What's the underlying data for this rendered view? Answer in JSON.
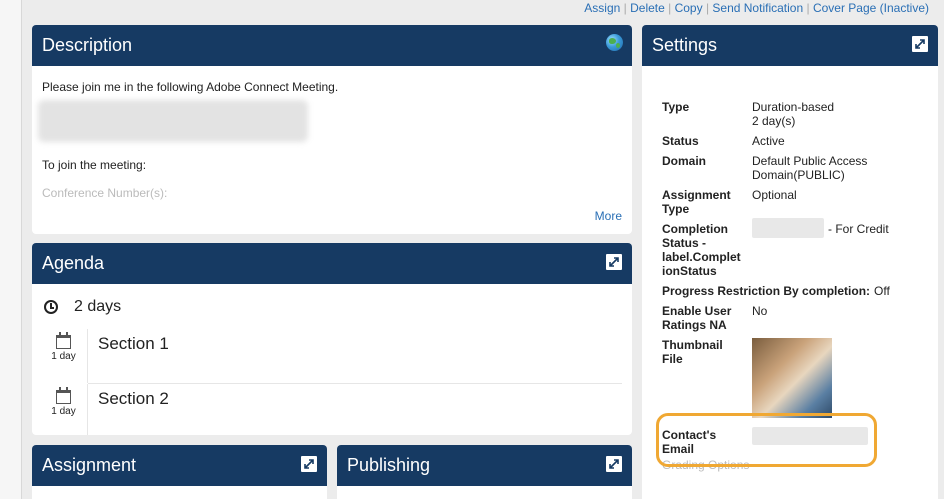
{
  "top_links": [
    "Assign",
    "Delete",
    "Copy",
    "Send Notification",
    "Cover Page (Inactive)"
  ],
  "description": {
    "title": "Description",
    "line1": "Please join me in the following Adobe Connect Meeting.",
    "line2": "To join the meeting:",
    "line3": "Conference Number(s):",
    "more": "More"
  },
  "agenda": {
    "title": "Agenda",
    "duration": "2 days",
    "sections": [
      {
        "day": "1 day",
        "title": "Section 1"
      },
      {
        "day": "1 day",
        "title": "Section 2"
      }
    ]
  },
  "assignment": {
    "title": "Assignment"
  },
  "publishing": {
    "title": "Publishing"
  },
  "settings": {
    "title": "Settings",
    "type_label": "Type",
    "type_value_1": "Duration-based",
    "type_value_2": "2 day(s)",
    "status_label": "Status",
    "status_value": "Active",
    "domain_label": "Domain",
    "domain_value_1": "Default Public Access",
    "domain_value_2": "Domain(PUBLIC)",
    "assignment_type_label_1": "Assignment",
    "assignment_type_label_2": "Type",
    "assignment_type_value": "Optional",
    "completion_label_1": "Completion",
    "completion_label_2": "Status -",
    "completion_label_3": "label.Complet",
    "completion_label_4": "ionStatus",
    "completion_value": "- For Credit",
    "progress_label": "Progress Restriction By completion:",
    "progress_value": "Off",
    "ratings_label_1": "Enable User",
    "ratings_label_2": "Ratings NA",
    "ratings_value": "No",
    "thumbnail_label_1": "Thumbnail",
    "thumbnail_label_2": "File",
    "contact_label_1": "Contact's",
    "contact_label_2": "Email",
    "grading_label": "Grading Options"
  }
}
